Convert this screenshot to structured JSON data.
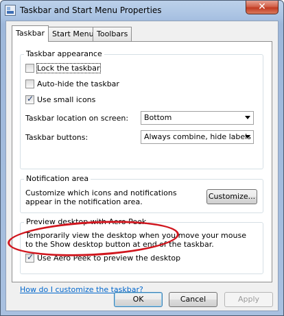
{
  "window": {
    "title": "Taskbar and Start Menu Properties",
    "close_label": "✕"
  },
  "tabs": [
    {
      "label": "Taskbar",
      "active": true
    },
    {
      "label": "Start Menu",
      "active": false
    },
    {
      "label": "Toolbars",
      "active": false
    }
  ],
  "taskbar_appearance": {
    "title": "Taskbar appearance",
    "lock_label": "Lock the taskbar",
    "lock_checked": false,
    "autohide_label": "Auto-hide the taskbar",
    "autohide_checked": false,
    "small_icons_label": "Use small icons",
    "small_icons_checked": true,
    "location_label": "Taskbar location on screen:",
    "location_value": "Bottom",
    "buttons_label": "Taskbar buttons:",
    "buttons_value": "Always combine, hide labels"
  },
  "notification_area": {
    "title": "Notification area",
    "description": "Customize which icons and notifications appear in the notification area.",
    "customize_label": "Customize..."
  },
  "aero_peek": {
    "title": "Preview desktop with Aero Peek",
    "description": "Temporarily view the desktop when you move your mouse to the Show desktop button at end of the taskbar.",
    "use_peek_label": "Use Aero Peek to preview the desktop",
    "use_peek_checked": true
  },
  "help_link": "How do I customize the taskbar?",
  "footer": {
    "ok_label": "OK",
    "cancel_label": "Cancel",
    "apply_label": "Apply"
  },
  "colors": {
    "annotation_ellipse": "#d0161e",
    "link": "#0066cc"
  }
}
